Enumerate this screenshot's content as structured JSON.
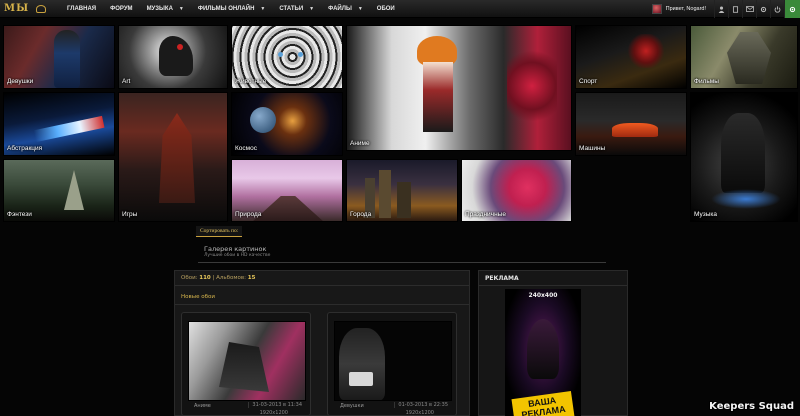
{
  "nav": {
    "logo": "МЫ",
    "items": [
      {
        "label": "ГЛАВНАЯ",
        "has_caret": false
      },
      {
        "label": "ФОРУМ",
        "has_caret": false
      },
      {
        "label": "МУЗЫКА",
        "has_caret": true
      },
      {
        "label": "ФИЛЬМЫ ОНЛАЙН",
        "has_caret": true
      },
      {
        "label": "СТАТЬИ",
        "has_caret": true
      },
      {
        "label": "ФАЙЛЫ",
        "has_caret": true
      },
      {
        "label": "ОБОИ",
        "has_caret": false
      }
    ],
    "caret_glyph": "▼",
    "greeting": "Привет, Nogard!",
    "icons": [
      "user-icon",
      "person-icon",
      "mail-icon",
      "settings-icon",
      "power-icon",
      "refresh-icon"
    ]
  },
  "categories": [
    {
      "label": "Девушки"
    },
    {
      "label": "Art"
    },
    {
      "label": "Животные"
    },
    {
      "label": "Аниме"
    },
    {
      "label": "Спорт"
    },
    {
      "label": "Фильмы"
    },
    {
      "label": "Абстракция"
    },
    {
      "label": "Игры"
    },
    {
      "label": "Космос"
    },
    {
      "label": "Машины"
    },
    {
      "label": "Фэнтези"
    },
    {
      "label": "Природа"
    },
    {
      "label": "Города"
    },
    {
      "label": "Праздничные"
    },
    {
      "label": "Музыка"
    }
  ],
  "sort": {
    "label": "Сортировать по:"
  },
  "gallery": {
    "title": "Галерея картинок",
    "subtitle": "Лучшие обои в HD качестве"
  },
  "main": {
    "stats_label": "Обои:",
    "stats_count": "110",
    "albums_label": "Альбомов:",
    "albums_count": "15",
    "new_label": "Новые обои"
  },
  "cards": [
    {
      "category": "Аниме",
      "date": "31-03-2013 в 11:34",
      "size": "1920x1200"
    },
    {
      "category": "Девушки",
      "date": "01-03-2013 в 22:35",
      "size": "1920x1200"
    }
  ],
  "ad": {
    "title": "РЕКЛАМА",
    "size": "240x400",
    "text": "ВАША РЕКЛАМА"
  },
  "watermark": "Keepers Squad",
  "colors": {
    "accent": "#d6b24a",
    "online": "#3a8a3a"
  }
}
